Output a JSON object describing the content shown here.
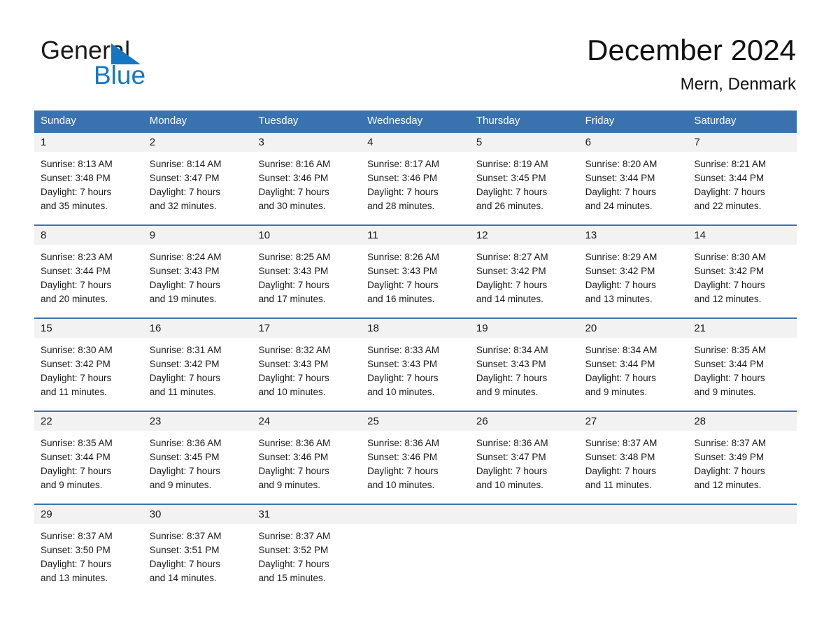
{
  "brand": {
    "name_part1": "General",
    "name_part2": "Blue"
  },
  "header": {
    "title": "December 2024",
    "subtitle": "Mern, Denmark"
  },
  "colors": {
    "header_blue": "#3a72b0",
    "logo_blue": "#1577c4",
    "day_band_gray": "#f2f2f2"
  },
  "weekdays": [
    "Sunday",
    "Monday",
    "Tuesday",
    "Wednesday",
    "Thursday",
    "Friday",
    "Saturday"
  ],
  "weeks": [
    [
      {
        "day": "1",
        "sunrise": "Sunrise: 8:13 AM",
        "sunset": "Sunset: 3:48 PM",
        "daylight1": "Daylight: 7 hours",
        "daylight2": "and 35 minutes."
      },
      {
        "day": "2",
        "sunrise": "Sunrise: 8:14 AM",
        "sunset": "Sunset: 3:47 PM",
        "daylight1": "Daylight: 7 hours",
        "daylight2": "and 32 minutes."
      },
      {
        "day": "3",
        "sunrise": "Sunrise: 8:16 AM",
        "sunset": "Sunset: 3:46 PM",
        "daylight1": "Daylight: 7 hours",
        "daylight2": "and 30 minutes."
      },
      {
        "day": "4",
        "sunrise": "Sunrise: 8:17 AM",
        "sunset": "Sunset: 3:46 PM",
        "daylight1": "Daylight: 7 hours",
        "daylight2": "and 28 minutes."
      },
      {
        "day": "5",
        "sunrise": "Sunrise: 8:19 AM",
        "sunset": "Sunset: 3:45 PM",
        "daylight1": "Daylight: 7 hours",
        "daylight2": "and 26 minutes."
      },
      {
        "day": "6",
        "sunrise": "Sunrise: 8:20 AM",
        "sunset": "Sunset: 3:44 PM",
        "daylight1": "Daylight: 7 hours",
        "daylight2": "and 24 minutes."
      },
      {
        "day": "7",
        "sunrise": "Sunrise: 8:21 AM",
        "sunset": "Sunset: 3:44 PM",
        "daylight1": "Daylight: 7 hours",
        "daylight2": "and 22 minutes."
      }
    ],
    [
      {
        "day": "8",
        "sunrise": "Sunrise: 8:23 AM",
        "sunset": "Sunset: 3:44 PM",
        "daylight1": "Daylight: 7 hours",
        "daylight2": "and 20 minutes."
      },
      {
        "day": "9",
        "sunrise": "Sunrise: 8:24 AM",
        "sunset": "Sunset: 3:43 PM",
        "daylight1": "Daylight: 7 hours",
        "daylight2": "and 19 minutes."
      },
      {
        "day": "10",
        "sunrise": "Sunrise: 8:25 AM",
        "sunset": "Sunset: 3:43 PM",
        "daylight1": "Daylight: 7 hours",
        "daylight2": "and 17 minutes."
      },
      {
        "day": "11",
        "sunrise": "Sunrise: 8:26 AM",
        "sunset": "Sunset: 3:43 PM",
        "daylight1": "Daylight: 7 hours",
        "daylight2": "and 16 minutes."
      },
      {
        "day": "12",
        "sunrise": "Sunrise: 8:27 AM",
        "sunset": "Sunset: 3:42 PM",
        "daylight1": "Daylight: 7 hours",
        "daylight2": "and 14 minutes."
      },
      {
        "day": "13",
        "sunrise": "Sunrise: 8:29 AM",
        "sunset": "Sunset: 3:42 PM",
        "daylight1": "Daylight: 7 hours",
        "daylight2": "and 13 minutes."
      },
      {
        "day": "14",
        "sunrise": "Sunrise: 8:30 AM",
        "sunset": "Sunset: 3:42 PM",
        "daylight1": "Daylight: 7 hours",
        "daylight2": "and 12 minutes."
      }
    ],
    [
      {
        "day": "15",
        "sunrise": "Sunrise: 8:30 AM",
        "sunset": "Sunset: 3:42 PM",
        "daylight1": "Daylight: 7 hours",
        "daylight2": "and 11 minutes."
      },
      {
        "day": "16",
        "sunrise": "Sunrise: 8:31 AM",
        "sunset": "Sunset: 3:42 PM",
        "daylight1": "Daylight: 7 hours",
        "daylight2": "and 11 minutes."
      },
      {
        "day": "17",
        "sunrise": "Sunrise: 8:32 AM",
        "sunset": "Sunset: 3:43 PM",
        "daylight1": "Daylight: 7 hours",
        "daylight2": "and 10 minutes."
      },
      {
        "day": "18",
        "sunrise": "Sunrise: 8:33 AM",
        "sunset": "Sunset: 3:43 PM",
        "daylight1": "Daylight: 7 hours",
        "daylight2": "and 10 minutes."
      },
      {
        "day": "19",
        "sunrise": "Sunrise: 8:34 AM",
        "sunset": "Sunset: 3:43 PM",
        "daylight1": "Daylight: 7 hours",
        "daylight2": "and 9 minutes."
      },
      {
        "day": "20",
        "sunrise": "Sunrise: 8:34 AM",
        "sunset": "Sunset: 3:44 PM",
        "daylight1": "Daylight: 7 hours",
        "daylight2": "and 9 minutes."
      },
      {
        "day": "21",
        "sunrise": "Sunrise: 8:35 AM",
        "sunset": "Sunset: 3:44 PM",
        "daylight1": "Daylight: 7 hours",
        "daylight2": "and 9 minutes."
      }
    ],
    [
      {
        "day": "22",
        "sunrise": "Sunrise: 8:35 AM",
        "sunset": "Sunset: 3:44 PM",
        "daylight1": "Daylight: 7 hours",
        "daylight2": "and 9 minutes."
      },
      {
        "day": "23",
        "sunrise": "Sunrise: 8:36 AM",
        "sunset": "Sunset: 3:45 PM",
        "daylight1": "Daylight: 7 hours",
        "daylight2": "and 9 minutes."
      },
      {
        "day": "24",
        "sunrise": "Sunrise: 8:36 AM",
        "sunset": "Sunset: 3:46 PM",
        "daylight1": "Daylight: 7 hours",
        "daylight2": "and 9 minutes."
      },
      {
        "day": "25",
        "sunrise": "Sunrise: 8:36 AM",
        "sunset": "Sunset: 3:46 PM",
        "daylight1": "Daylight: 7 hours",
        "daylight2": "and 10 minutes."
      },
      {
        "day": "26",
        "sunrise": "Sunrise: 8:36 AM",
        "sunset": "Sunset: 3:47 PM",
        "daylight1": "Daylight: 7 hours",
        "daylight2": "and 10 minutes."
      },
      {
        "day": "27",
        "sunrise": "Sunrise: 8:37 AM",
        "sunset": "Sunset: 3:48 PM",
        "daylight1": "Daylight: 7 hours",
        "daylight2": "and 11 minutes."
      },
      {
        "day": "28",
        "sunrise": "Sunrise: 8:37 AM",
        "sunset": "Sunset: 3:49 PM",
        "daylight1": "Daylight: 7 hours",
        "daylight2": "and 12 minutes."
      }
    ],
    [
      {
        "day": "29",
        "sunrise": "Sunrise: 8:37 AM",
        "sunset": "Sunset: 3:50 PM",
        "daylight1": "Daylight: 7 hours",
        "daylight2": "and 13 minutes."
      },
      {
        "day": "30",
        "sunrise": "Sunrise: 8:37 AM",
        "sunset": "Sunset: 3:51 PM",
        "daylight1": "Daylight: 7 hours",
        "daylight2": "and 14 minutes."
      },
      {
        "day": "31",
        "sunrise": "Sunrise: 8:37 AM",
        "sunset": "Sunset: 3:52 PM",
        "daylight1": "Daylight: 7 hours",
        "daylight2": "and 15 minutes."
      },
      {
        "day": "",
        "sunrise": "",
        "sunset": "",
        "daylight1": "",
        "daylight2": ""
      },
      {
        "day": "",
        "sunrise": "",
        "sunset": "",
        "daylight1": "",
        "daylight2": ""
      },
      {
        "day": "",
        "sunrise": "",
        "sunset": "",
        "daylight1": "",
        "daylight2": ""
      },
      {
        "day": "",
        "sunrise": "",
        "sunset": "",
        "daylight1": "",
        "daylight2": ""
      }
    ]
  ]
}
